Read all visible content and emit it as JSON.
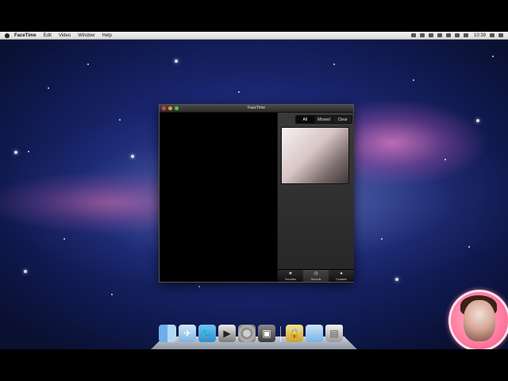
{
  "menubar": {
    "app_name": "FaceTime",
    "items": [
      "Edit",
      "Video",
      "Window",
      "Help"
    ],
    "clock": "10:39"
  },
  "window": {
    "title": "FaceTime",
    "segments": [
      "All",
      "Missed",
      "Clear"
    ],
    "active_segment": "All",
    "tabs": [
      {
        "label": "Favorites",
        "icon": "star-icon"
      },
      {
        "label": "Recents",
        "icon": "clock-icon"
      },
      {
        "label": "Contacts",
        "icon": "person-icon"
      }
    ],
    "active_tab": "Recents"
  },
  "dock": {
    "apps": [
      "finder-icon",
      "mail-icon",
      "twitter-icon",
      "imovie-icon",
      "system-preferences-icon",
      "facetime-icon",
      "keychain-icon",
      "folder-icon",
      "trash-icon"
    ]
  },
  "colors": {
    "window_bg": "#000000",
    "panel_bg": "#2e2e2e",
    "close": "#e0443e",
    "minimize": "#dea236",
    "zoom": "#5fbd47",
    "avatar_ring": "#ff7aa0"
  }
}
